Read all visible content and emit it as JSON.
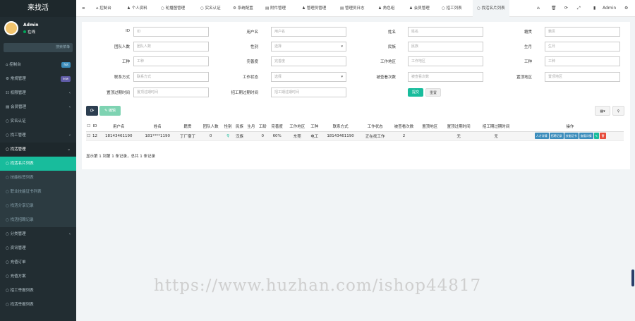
{
  "sidebar": {
    "logo": "来找活",
    "user": "Admin",
    "status": "在线",
    "search_placeholder": "搜索菜单",
    "items": [
      {
        "label": "控制台",
        "badge": "hot",
        "badge_color": "#3c8dbc"
      },
      {
        "label": "常规管理",
        "badge": "new",
        "badge_color": "#605ca8"
      },
      {
        "label": "权限管理",
        "arrow": "‹"
      },
      {
        "label": "会员管理",
        "arrow": "‹"
      },
      {
        "label": "实名认证"
      },
      {
        "label": "找工管理",
        "arrow": "‹"
      },
      {
        "label": "找活管理",
        "arrow": "⌄",
        "open": true
      }
    ],
    "sub": [
      "找活名片列表",
      "技能标签列表",
      "职业技能证书列表",
      "找活分享记录",
      "找活招聘记录"
    ],
    "bottom": [
      {
        "label": "分类管理",
        "arrow": "‹"
      },
      {
        "label": "资讯管理"
      },
      {
        "label": "充值订单"
      },
      {
        "label": "充值方案"
      },
      {
        "label": "招工举报列表"
      },
      {
        "label": "找活举报列表"
      }
    ]
  },
  "topbar": {
    "menu_icon": "≡",
    "tabs": [
      "控制台",
      "个人资料",
      "轮播图管理",
      "实名认证",
      "系统配置",
      "附件管理",
      "管理员管理",
      "管理员日志",
      "角色组",
      "会员管理",
      "招工列表",
      "找活名片列表"
    ],
    "admin": "Admin"
  },
  "filters": {
    "rows": [
      [
        {
          "label": "ID",
          "ph": "ID"
        },
        {
          "label": "用户名",
          "ph": "用户名"
        },
        {
          "label": "姓名",
          "ph": "姓名"
        },
        {
          "label": "籍贯",
          "ph": "籍贯"
        }
      ],
      [
        {
          "label": "团队人数",
          "ph": "团队人数"
        },
        {
          "label": "性别",
          "ph": "选择",
          "select": true
        },
        {
          "label": "民族",
          "ph": "民族"
        },
        {
          "label": "生月",
          "ph": "生月"
        }
      ],
      [
        {
          "label": "工种",
          "ph": "工种"
        },
        {
          "label": "完善度",
          "ph": "完善度"
        },
        {
          "label": "工作地区",
          "ph": "工作地区"
        },
        {
          "label": "工种",
          "ph": "工种"
        }
      ],
      [
        {
          "label": "联系方式",
          "ph": "联系方式"
        },
        {
          "label": "工作状态",
          "ph": "选择",
          "select": true
        },
        {
          "label": "被查看次数",
          "ph": "被查看次数"
        },
        {
          "label": "置顶地区",
          "ph": "置顶地区"
        }
      ],
      [
        {
          "label": "置顶过期时间",
          "ph": "置顶过期时间"
        },
        {
          "label": "招工期过期时间",
          "ph": "招工期过期时间"
        }
      ]
    ],
    "submit": "提交",
    "reset": "重置"
  },
  "toolbar": {
    "refresh_icon": "⟳",
    "edit_label": "编辑",
    "columns_icon": "▦▾",
    "search_icon": "⚲"
  },
  "table": {
    "headers": [
      "",
      "ID",
      "用户名",
      "姓名",
      "籍贯",
      "团队人数",
      "性别",
      "民族",
      "生月",
      "工龄",
      "完善度",
      "工作地区",
      "工种",
      "联系方式",
      "工作状态",
      "被查看次数",
      "置顶地区",
      "置顶过期时间",
      "招工期过期时间",
      "操作"
    ],
    "rows": [
      [
        "",
        "12",
        "18143461190",
        "181****1190",
        "丁厂宿丁",
        "0",
        "♀",
        "汉族",
        "",
        "0",
        "60%",
        "东莞",
        "电工",
        "18143461190",
        "正在找工作",
        "2",
        "",
        "无",
        "无",
        ""
      ]
    ],
    "actions": [
      {
        "label": "人才详情",
        "color": "#3c8dbc"
      },
      {
        "label": "招聘记录",
        "color": "#3c8dbc"
      },
      {
        "label": "技能证书",
        "color": "#3c8dbc"
      },
      {
        "label": "查看详情",
        "color": "#3c8dbc"
      },
      {
        "label": "✎",
        "color": "#18bc9c"
      },
      {
        "label": "🗑",
        "color": "#e74c3c"
      }
    ],
    "footer": "显示第 1 到第 1 条记录，总共 1 条记录"
  },
  "watermark": "https://www.huzhan.com/ishop44817"
}
